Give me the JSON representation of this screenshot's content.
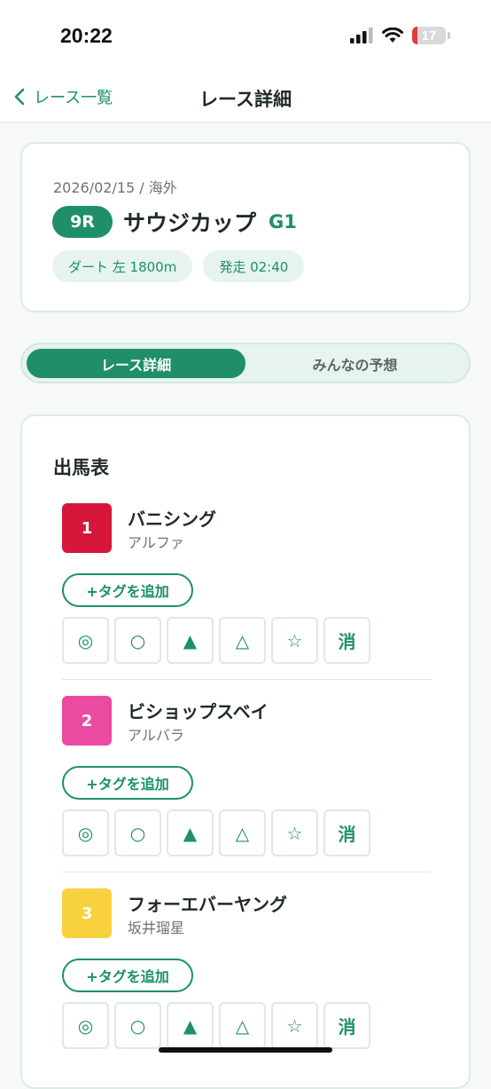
{
  "status": {
    "time": "20:22",
    "battery": "17"
  },
  "nav": {
    "back_label": "レース一覧",
    "title": "レース詳細"
  },
  "race": {
    "date": "2026/02/15 / 海外",
    "number": "9R",
    "name": "サウジカップ",
    "grade": "G1",
    "course": "ダート 左 1800m",
    "start": "発走 02:40"
  },
  "tabs": {
    "active": "レース詳細",
    "inactive": "みんなの予想"
  },
  "entries": {
    "title": "出馬表",
    "add_tag_label": "+タグを追加",
    "marks": [
      "◎",
      "○",
      "▲",
      "△",
      "☆",
      "消"
    ],
    "horses": [
      {
        "number": "1",
        "color": "#d6173b",
        "name": "バニシング",
        "jockey": "アルファ"
      },
      {
        "number": "2",
        "color": "#ea4aa0",
        "name": "ビショップスベイ",
        "jockey": "アルバラ"
      },
      {
        "number": "3",
        "color": "#f7d23e",
        "name": "フォーエバーヤング",
        "jockey": "坂井瑠星"
      }
    ]
  }
}
